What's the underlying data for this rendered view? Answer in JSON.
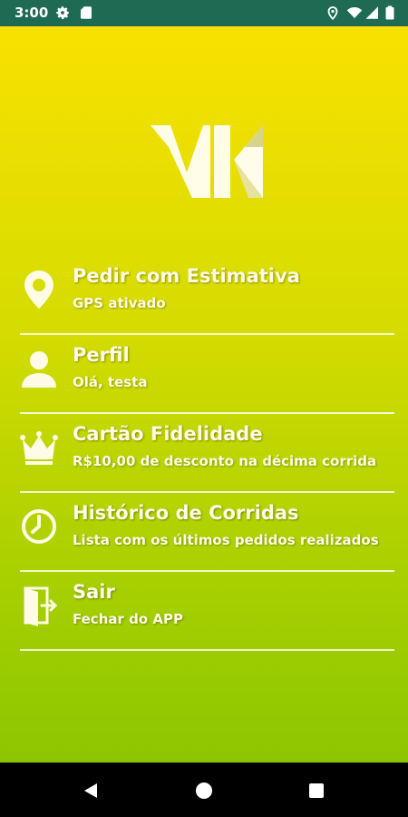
{
  "status_bar": {
    "time": "3:00",
    "background": "#1e6a52",
    "icons": [
      "gear-icon",
      "sd-card-icon",
      "location-icon",
      "wifi-icon",
      "signal-icon",
      "battery-icon"
    ]
  },
  "app": {
    "logo_text": "VK",
    "gradient": [
      "#f9e100",
      "#8cc600"
    ],
    "menu": [
      {
        "title": "Pedir com Estimativa",
        "subtitle": "GPS ativado",
        "icon": "location-pin-icon"
      },
      {
        "title": "Perfil",
        "subtitle": "Olá, testa",
        "icon": "user-icon"
      },
      {
        "title": "Cartão Fidelidade",
        "subtitle": "R$10,00 de desconto na décima corrida",
        "icon": "crown-icon"
      },
      {
        "title": "Histórico de Corridas",
        "subtitle": "Lista com os últimos pedidos realizados",
        "icon": "clock-icon"
      },
      {
        "title": "Sair",
        "subtitle": "Fechar do APP",
        "icon": "exit-door-icon"
      }
    ]
  },
  "nav_bar": {
    "buttons": [
      "back-icon",
      "home-icon",
      "recents-icon"
    ]
  }
}
